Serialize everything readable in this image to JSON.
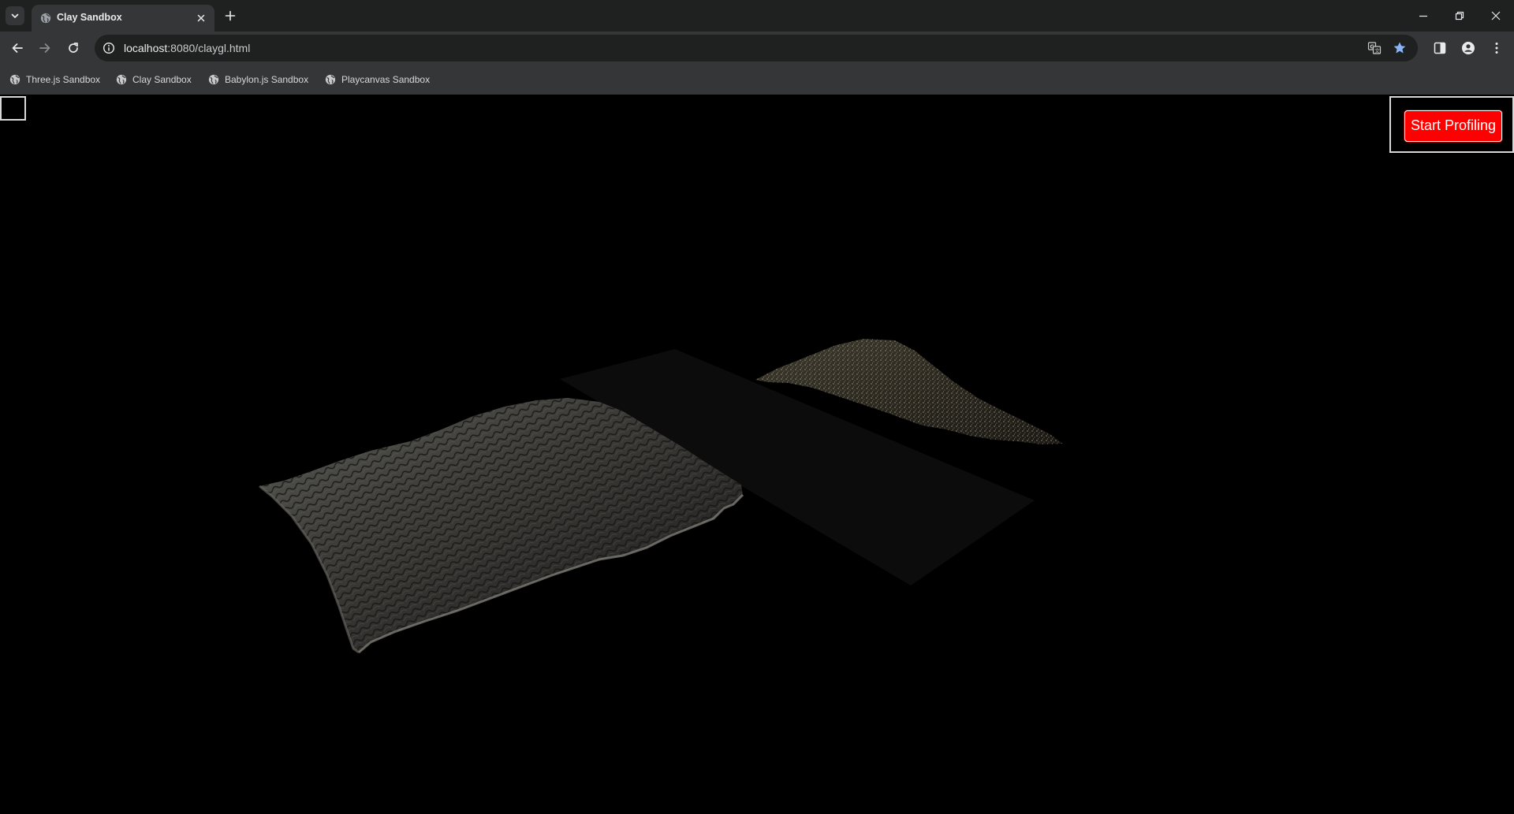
{
  "tab": {
    "title": "Clay Sandbox"
  },
  "toolbar": {
    "url_host": "localhost",
    "url_path": ":8080/claygl.html"
  },
  "bookmarks": [
    {
      "label": "Three.js Sandbox"
    },
    {
      "label": "Clay Sandbox"
    },
    {
      "label": "Babylon.js Sandbox"
    },
    {
      "label": "Playcanvas Sandbox"
    }
  ],
  "page": {
    "profiling_button_label": "Start Profiling"
  },
  "colors": {
    "tabstrip_bg": "#1f2020",
    "toolbar_bg": "#353637",
    "canvas_bg": "#000000",
    "profiling_button": "#ff0000",
    "bookmark_star": "#8ab4f8"
  },
  "icons": {
    "tab_search": "chevron-down-icon",
    "favicon": "globe-icon",
    "tab_close": "close-icon",
    "new_tab": "plus-icon",
    "back": "arrow-left-icon",
    "forward": "arrow-right-icon",
    "reload": "reload-icon",
    "site_info": "info-icon",
    "translate": "translate-icon",
    "bookmark": "star-icon",
    "side_panel": "side-panel-icon",
    "profile": "person-icon",
    "menu": "kebab-menu-icon"
  }
}
